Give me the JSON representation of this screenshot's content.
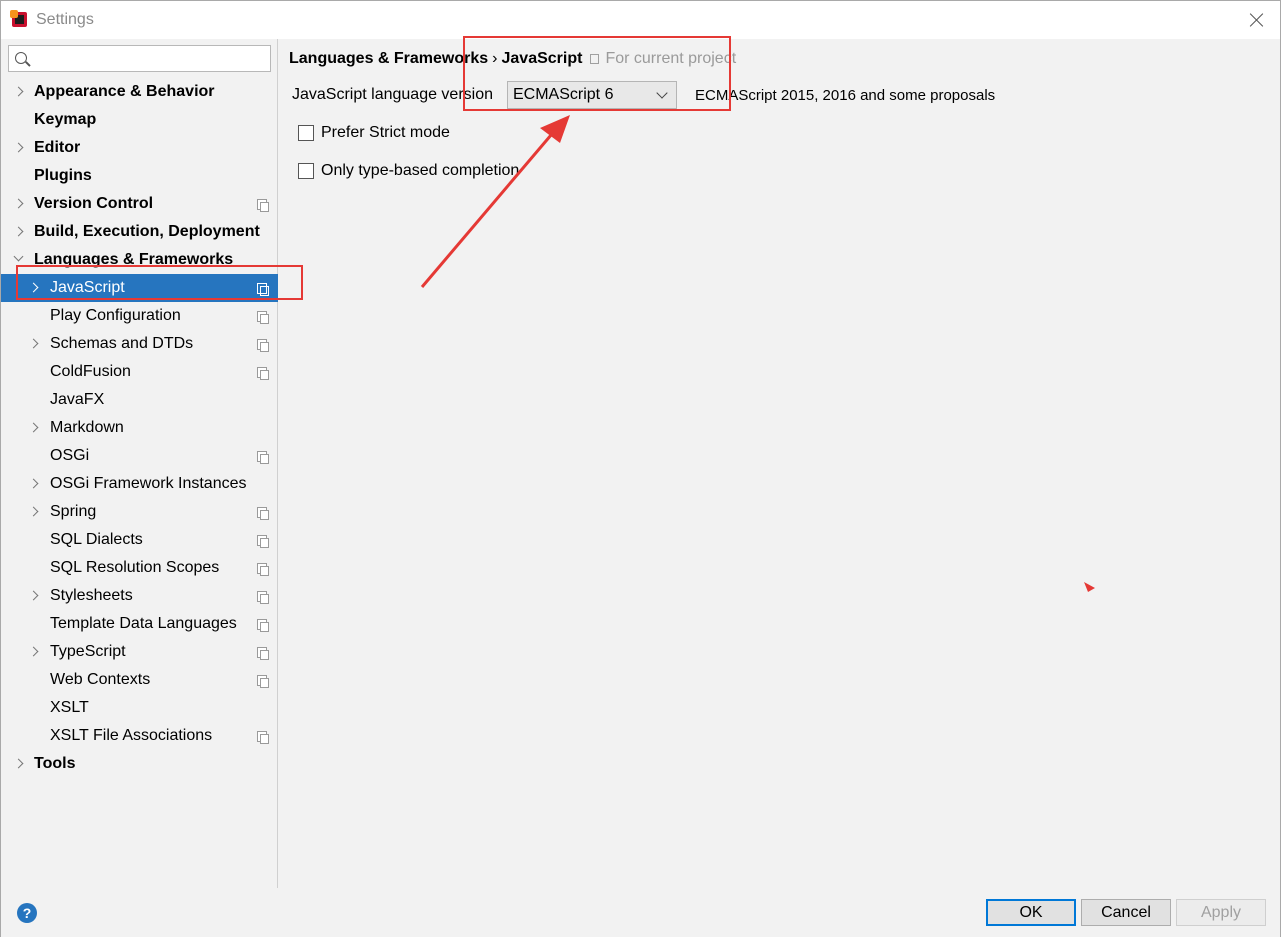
{
  "window": {
    "title": "Settings"
  },
  "search": {
    "value": "",
    "placeholder": ""
  },
  "sidebar": {
    "items": [
      {
        "label": "Appearance & Behavior",
        "bold": true,
        "level": 0,
        "expandable": true,
        "expanded": false,
        "project": false
      },
      {
        "label": "Keymap",
        "bold": true,
        "level": 0,
        "expandable": false,
        "expanded": false,
        "project": false
      },
      {
        "label": "Editor",
        "bold": true,
        "level": 0,
        "expandable": true,
        "expanded": false,
        "project": false
      },
      {
        "label": "Plugins",
        "bold": true,
        "level": 0,
        "expandable": false,
        "expanded": false,
        "project": false
      },
      {
        "label": "Version Control",
        "bold": true,
        "level": 0,
        "expandable": true,
        "expanded": false,
        "project": true
      },
      {
        "label": "Build, Execution, Deployment",
        "bold": true,
        "level": 0,
        "expandable": true,
        "expanded": false,
        "project": false
      },
      {
        "label": "Languages & Frameworks",
        "bold": true,
        "level": 0,
        "expandable": true,
        "expanded": true,
        "project": false
      },
      {
        "label": "JavaScript",
        "bold": false,
        "level": 1,
        "expandable": true,
        "expanded": false,
        "project": true,
        "selected": true
      },
      {
        "label": "Play Configuration",
        "bold": false,
        "level": 1,
        "expandable": false,
        "expanded": false,
        "project": true
      },
      {
        "label": "Schemas and DTDs",
        "bold": false,
        "level": 1,
        "expandable": true,
        "expanded": false,
        "project": true
      },
      {
        "label": "ColdFusion",
        "bold": false,
        "level": 1,
        "expandable": false,
        "expanded": false,
        "project": true
      },
      {
        "label": "JavaFX",
        "bold": false,
        "level": 1,
        "expandable": false,
        "expanded": false,
        "project": false
      },
      {
        "label": "Markdown",
        "bold": false,
        "level": 1,
        "expandable": true,
        "expanded": false,
        "project": false
      },
      {
        "label": "OSGi",
        "bold": false,
        "level": 1,
        "expandable": false,
        "expanded": false,
        "project": true
      },
      {
        "label": "OSGi Framework Instances",
        "bold": false,
        "level": 1,
        "expandable": true,
        "expanded": false,
        "project": false
      },
      {
        "label": "Spring",
        "bold": false,
        "level": 1,
        "expandable": true,
        "expanded": false,
        "project": true
      },
      {
        "label": "SQL Dialects",
        "bold": false,
        "level": 1,
        "expandable": false,
        "expanded": false,
        "project": true
      },
      {
        "label": "SQL Resolution Scopes",
        "bold": false,
        "level": 1,
        "expandable": false,
        "expanded": false,
        "project": true
      },
      {
        "label": "Stylesheets",
        "bold": false,
        "level": 1,
        "expandable": true,
        "expanded": false,
        "project": true
      },
      {
        "label": "Template Data Languages",
        "bold": false,
        "level": 1,
        "expandable": false,
        "expanded": false,
        "project": true
      },
      {
        "label": "TypeScript",
        "bold": false,
        "level": 1,
        "expandable": true,
        "expanded": false,
        "project": true
      },
      {
        "label": "Web Contexts",
        "bold": false,
        "level": 1,
        "expandable": false,
        "expanded": false,
        "project": true
      },
      {
        "label": "XSLT",
        "bold": false,
        "level": 1,
        "expandable": false,
        "expanded": false,
        "project": false
      },
      {
        "label": "XSLT File Associations",
        "bold": false,
        "level": 1,
        "expandable": false,
        "expanded": false,
        "project": true
      },
      {
        "label": "Tools",
        "bold": true,
        "level": 0,
        "expandable": true,
        "expanded": false,
        "project": false
      }
    ]
  },
  "content": {
    "breadcrumb": {
      "parent": "Languages & Frameworks",
      "separator": "›",
      "current": "JavaScript",
      "scope_note": "For current project"
    },
    "language_version": {
      "label": "JavaScript language version",
      "selected": "ECMAScript 6",
      "description": "ECMAScript 2015, 2016 and some proposals"
    },
    "options": [
      {
        "label": "Prefer Strict mode",
        "checked": false
      },
      {
        "label": "Only type-based completion",
        "checked": false
      }
    ]
  },
  "footer": {
    "help": "?",
    "ok": "OK",
    "cancel": "Cancel",
    "apply": "Apply"
  },
  "colors": {
    "selection": "#2675bf",
    "annotation": "#e53935",
    "ok_border": "#0078d7"
  }
}
